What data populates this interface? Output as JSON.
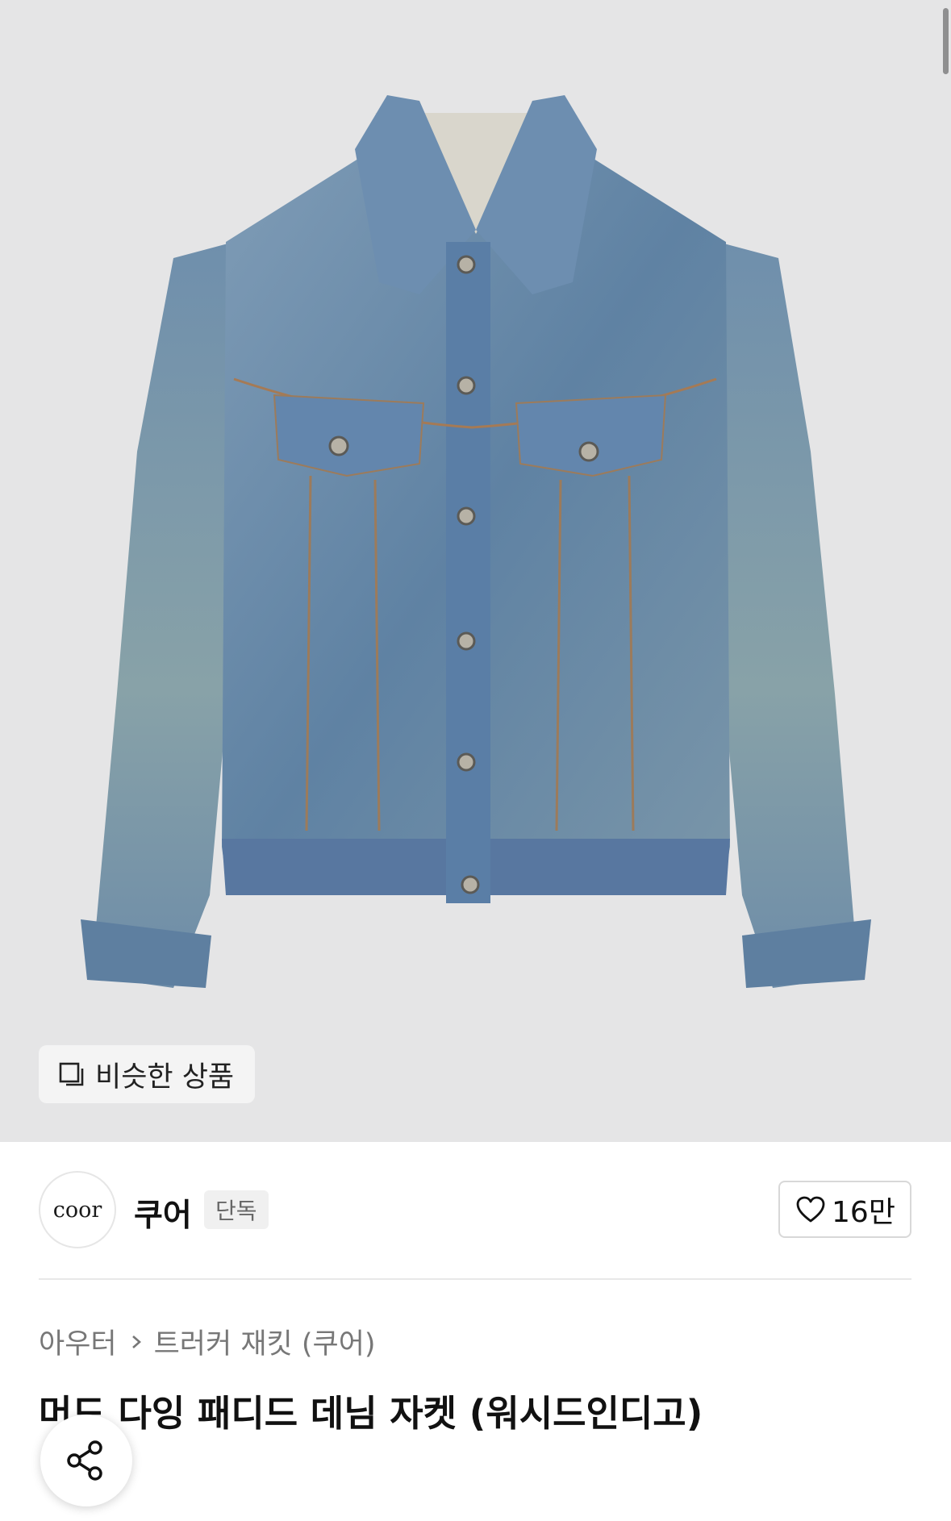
{
  "colors": {
    "background": "#ffffff",
    "hero_background": "#e5e5e6",
    "denim": "#6a8aa8",
    "text_primary": "#111111",
    "text_secondary": "#777777"
  },
  "similar_products": {
    "label": "비슷한 상품",
    "icon": "similar-icon"
  },
  "brand": {
    "logo_text": "coor",
    "name": "쿠어",
    "badge": "단독"
  },
  "like": {
    "count": "16만",
    "icon": "heart-icon"
  },
  "breadcrumb": {
    "items": [
      "아우터",
      "트러커 재킷 (쿠어)"
    ],
    "separator_icon": "chevron-right-icon"
  },
  "product": {
    "title": "머드 다잉 패디드 데님 자켓 (워시드인디고)"
  },
  "share": {
    "icon": "share-icon"
  }
}
